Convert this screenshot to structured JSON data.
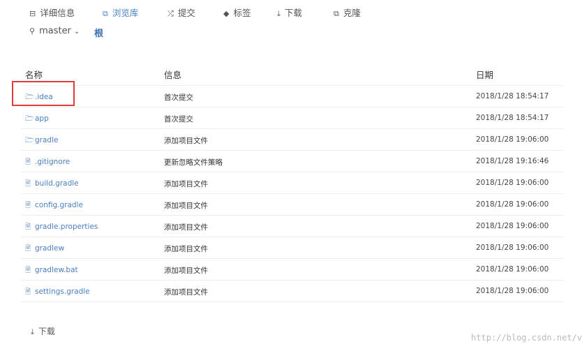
{
  "tabs": [
    {
      "label": "详细信息",
      "icon": "print-icon",
      "glyph": "⊟"
    },
    {
      "label": "浏览库",
      "icon": "copy-icon",
      "glyph": "⧉",
      "active": true
    },
    {
      "label": "提交",
      "icon": "shuffle-icon",
      "glyph": "⤮"
    },
    {
      "label": "标签",
      "icon": "tag-icon",
      "glyph": "◆"
    },
    {
      "label": "下载",
      "icon": "download-icon",
      "glyph": "⤓"
    },
    {
      "label": "克隆",
      "icon": "clone-icon",
      "glyph": "⧉"
    }
  ],
  "branch": {
    "icon": "branch-icon",
    "glyph": "⚲",
    "name": "master",
    "chevron": "⌄"
  },
  "path_root": "根",
  "table": {
    "headers": [
      "名称",
      "信息",
      "日期"
    ],
    "rows": [
      {
        "type": "folder",
        "name": ".idea",
        "message": "首次提交",
        "date": "2018/1/28 18:54:17"
      },
      {
        "type": "folder",
        "name": "app",
        "message": "首次提交",
        "date": "2018/1/28 18:54:17"
      },
      {
        "type": "folder",
        "name": "gradle",
        "message": "添加项目文件",
        "date": "2018/1/28 19:06:00"
      },
      {
        "type": "file",
        "name": ".gitignore",
        "message": "更新忽略文件策略",
        "date": "2018/1/28 19:16:46"
      },
      {
        "type": "file",
        "name": "build.gradle",
        "message": "添加项目文件",
        "date": "2018/1/28 19:06:00"
      },
      {
        "type": "file",
        "name": "config.gradle",
        "message": "添加项目文件",
        "date": "2018/1/28 19:06:00"
      },
      {
        "type": "file",
        "name": "gradle.properties",
        "message": "添加项目文件",
        "date": "2018/1/28 19:06:00"
      },
      {
        "type": "file",
        "name": "gradlew",
        "message": "添加项目文件",
        "date": "2018/1/28 19:06:00"
      },
      {
        "type": "file",
        "name": "gradlew.bat",
        "message": "添加项目文件",
        "date": "2018/1/28 19:06:00"
      },
      {
        "type": "file",
        "name": "settings.gradle",
        "message": "添加项目文件",
        "date": "2018/1/28 19:06:00"
      }
    ]
  },
  "download_label": "下载",
  "watermark": "http://blog.csdn.net/v"
}
